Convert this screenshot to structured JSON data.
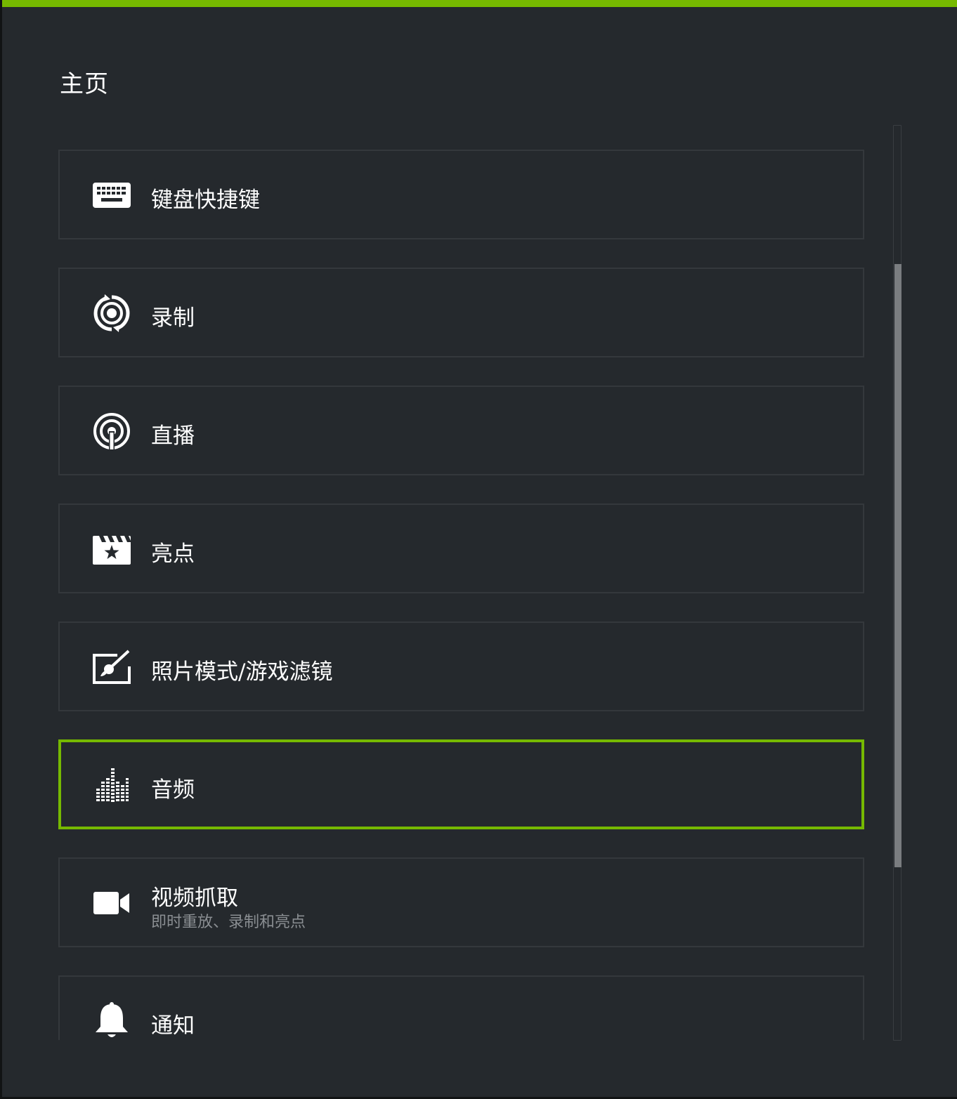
{
  "page": {
    "title": "主页",
    "accent_color": "#76b900",
    "background_color": "#25292d"
  },
  "menu": {
    "items": [
      {
        "label": "键盘快捷键",
        "icon": "keyboard-icon"
      },
      {
        "label": "录制",
        "icon": "record-icon"
      },
      {
        "label": "直播",
        "icon": "broadcast-icon"
      },
      {
        "label": "亮点",
        "icon": "highlights-icon"
      },
      {
        "label": "照片模式/游戏滤镜",
        "icon": "photo-mode-icon"
      },
      {
        "label": "音频",
        "icon": "audio-icon",
        "selected": true
      },
      {
        "label": "视频抓取",
        "sublabel": "即时重放、录制和亮点",
        "icon": "video-camera-icon"
      },
      {
        "label": "通知",
        "icon": "bell-icon"
      }
    ]
  },
  "scrollbar": {
    "visible_fraction": 0.66,
    "position": "middle"
  }
}
